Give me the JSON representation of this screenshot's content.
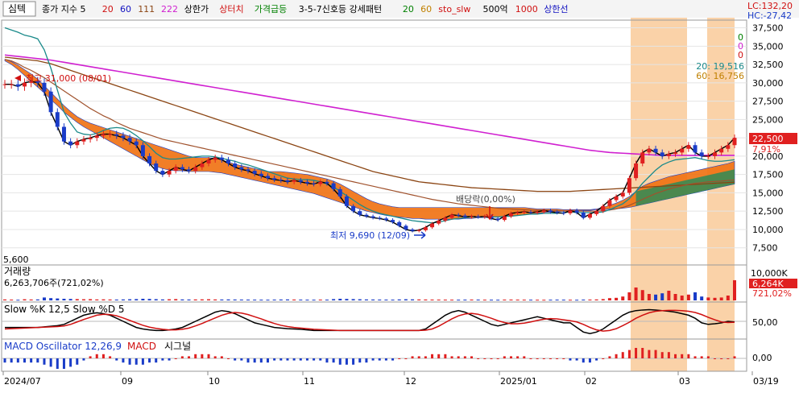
{
  "toolbar": {
    "tab_label": "심텍",
    "items": [
      {
        "label": "종가 지수 5",
        "color": "#000000"
      },
      {
        "label": "20",
        "color": "#d01010"
      },
      {
        "label": "60",
        "color": "#1010c0"
      },
      {
        "label": "111",
        "color": "#8b4513"
      },
      {
        "label": "222",
        "color": "#d020d0"
      },
      {
        "label": "상한가",
        "color": "#000000"
      },
      {
        "label": "상터치",
        "color": "#d01010"
      },
      {
        "label": "가격급등",
        "color": "#008000"
      },
      {
        "label": "3-5-7신호등 강세패턴",
        "color": "#000000"
      },
      {
        "label": "20",
        "color": "#008000"
      },
      {
        "label": "60",
        "color": "#c08000"
      },
      {
        "label": "sto_slw",
        "color": "#d01010"
      },
      {
        "label": "500억",
        "color": "#000000"
      },
      {
        "label": "1000",
        "color": "#d01010"
      },
      {
        "label": "상한선",
        "color": "#1010c0"
      }
    ]
  },
  "price_panel": {
    "lc_label": "LC:132,20",
    "hc_label": "HC:-27,42",
    "current_price": "22,500",
    "current_pct": "7,91%",
    "ma20_label": "20: 19,516",
    "ma60_label": "60: 16,756",
    "zero_labels": [
      "0",
      "0",
      "0"
    ],
    "bottom_label": "5,600",
    "high_annotation": "최고 31,000 (08/01)",
    "low_annotation": "최저 9,690 (12/09)",
    "dividend_annotation": "배당락(0,00%)"
  },
  "volume_panel": {
    "title": "거래량",
    "value_text": "6,263,706주(721,02%)",
    "axis_label": "10,000K",
    "current_label": "6,264K",
    "current_pct": "721,02%"
  },
  "stoch_panel": {
    "title": "Slow %K 12,5  Slow %D 5",
    "axis_label": "50,00"
  },
  "macd_panel": {
    "title_prefix": "MACD Oscillator 12,26,9",
    "title_macd": "MACD",
    "title_signal": "시그널",
    "axis_label": "0,00"
  },
  "x_axis": {
    "labels": [
      "2024/07",
      "09",
      "10",
      "11",
      "12",
      "2025/01",
      "02",
      "03",
      "03/19"
    ]
  },
  "colors": {
    "up": "#e02020",
    "down": "#1a3cc8",
    "ma5": "#000000",
    "ma20": "#1a8a8a",
    "ma60": "#8b4513",
    "ma222": "#d020d0",
    "cloud_orange": "#f07010",
    "cloud_green": "#2e8b57",
    "highlight": "#fad2a8",
    "price_tag_bg": "#e02020"
  },
  "chart_data": {
    "type": "candlestick",
    "title": "",
    "y_ticks": [
      7500,
      10000,
      12500,
      15000,
      17500,
      20000,
      22500,
      25000,
      27500,
      30000,
      32500,
      35000,
      37500
    ],
    "ylim": [
      5600,
      38000
    ],
    "x_categories": [
      "2024/07",
      "09",
      "10",
      "11",
      "12",
      "2025/01",
      "02",
      "03",
      "03/19"
    ],
    "closes": [
      29800,
      29800,
      29500,
      30000,
      30200,
      30000,
      28800,
      26000,
      24000,
      22000,
      21500,
      22000,
      22300,
      22500,
      22800,
      23000,
      23000,
      22800,
      22500,
      22000,
      21500,
      20000,
      19000,
      18000,
      17500,
      18000,
      18500,
      18200,
      18000,
      18500,
      19000,
      19500,
      19800,
      19500,
      19000,
      18500,
      18200,
      18000,
      17600,
      17300,
      17000,
      16800,
      16700,
      16500,
      16700,
      16500,
      16300,
      16200,
      16500,
      16300,
      15500,
      14500,
      13200,
      12500,
      12000,
      11800,
      11600,
      11500,
      11300,
      11000,
      10500,
      10000,
      9800,
      9900,
      10300,
      10800,
      11200,
      11600,
      12000,
      11900,
      11700,
      11800,
      11700,
      11800,
      11500,
      11300,
      11800,
      12200,
      12300,
      12400,
      12300,
      12400,
      12600,
      12400,
      12300,
      12200,
      12600,
      12300,
      11600,
      12100,
      12500,
      13200,
      14000,
      14500,
      15000,
      17000,
      19000,
      20500,
      21000,
      20500,
      20000,
      20300,
      20500,
      21000,
      21500,
      20500,
      20000,
      20000,
      20500,
      21000,
      21500,
      22500
    ],
    "ma20": [
      37500,
      37200,
      36900,
      36500,
      36300,
      36000,
      34500,
      32000,
      29000,
      26000,
      24500,
      23300,
      23000,
      22900,
      23100,
      23500,
      23800,
      23900,
      23800,
      23400,
      22800,
      22100,
      21300,
      20400,
      19800,
      19600,
      19600,
      19700,
      19800,
      19900,
      20000,
      20000,
      19900,
      19700,
      19500,
      19300,
      19000,
      18800,
      18500,
      18200,
      17900,
      17600,
      17300,
      17000,
      16900,
      16800,
      16800,
      16700,
      16500,
      16200,
      15800,
      15200,
      14600,
      14000,
      13400,
      12900,
      12500,
      12200,
      12000,
      11800,
      11600,
      11400,
      11200,
      11100,
      11000,
      10900,
      11000,
      11200,
      11400,
      11500,
      11600,
      11700,
      11700,
      11700,
      11700,
      11700,
      11800,
      11800,
      11900,
      12000,
      12100,
      12100,
      12200,
      12200,
      12200,
      12300,
      12400,
      12300,
      12300,
      12300,
      12300,
      12400,
      12700,
      13100,
      13500,
      14200,
      15200,
      16300,
      17200,
      18100,
      18800,
      19200,
      19500,
      19600,
      19700,
      19800,
      19600,
      19400,
      19300,
      19300,
      19400,
      19516
    ],
    "ma60": [
      33200,
      33000,
      32600,
      32100,
      31700,
      31200,
      30700,
      30100,
      29500,
      28900,
      28300,
      27700,
      27100,
      26500,
      26000,
      25500,
      25100,
      24600,
      24200,
      23800,
      23500,
      23200,
      22900,
      22600,
      22300,
      22100,
      21900,
      21700,
      21500,
      21300,
      21100,
      20900,
      20700,
      20500,
      20300,
      20100,
      19900,
      19700,
      19500,
      19300,
      19100,
      18900,
      18700,
      18500,
      18300,
      18100,
      17900,
      17700,
      17500,
      17300,
      17100,
      16900,
      16700,
      16500,
      16300,
      16100,
      15900,
      15700,
      15500,
      15300,
      15100,
      14900,
      14700,
      14500,
      14300,
      14100,
      13950,
      13800,
      13650,
      13500,
      13400,
      13300,
      13200,
      13100,
      13000,
      12900,
      12850,
      12800,
      12750,
      12700,
      12650,
      12600,
      12600,
      12550,
      12550,
      12500,
      12500,
      12500,
      12500,
      12500,
      12500,
      12550,
      12650,
      12800,
      13000,
      13300,
      13700,
      14100,
      14500,
      14900,
      15200,
      15500,
      15750,
      15950,
      16150,
      16300,
      16400,
      16500,
      16550,
      16600,
      16700,
      16756
    ],
    "ma111": [
      33500,
      33400,
      33300,
      33200,
      33100,
      33000,
      32800,
      32600,
      32300,
      32000,
      31700,
      31400,
      31100,
      30800,
      30500,
      30200,
      29900,
      29600,
      29300,
      29000,
      28700,
      28400,
      28100,
      27800,
      27500,
      27200,
      26900,
      26600,
      26300,
      26000,
      25700,
      25400,
      25100,
      24800,
      24500,
      24200,
      23900,
      23600,
      23300,
      23000,
      22700,
      22400,
      22100,
      21800,
      21500,
      21200,
      20900,
      20600,
      20300,
      20000,
      19700,
      19400,
      19100,
      18800,
      18500,
      18200,
      17900,
      17700,
      17500,
      17300,
      17100,
      16900,
      16700,
      16500,
      16400,
      16300,
      16200,
      16100,
      16000,
      15900,
      15800,
      15700,
      15650,
      15600,
      15550,
      15500,
      15450,
      15400,
      15350,
      15300,
      15250,
      15200,
      15200,
      15200,
      15200,
      15200,
      15200,
      15250,
      15300,
      15350,
      15400,
      15450,
      15500,
      15550,
      15600,
      15650,
      15700,
      15750,
      15800,
      15850,
      15900,
      15950,
      16000,
      16050,
      16100,
      16150,
      16200,
      16250,
      16300,
      16350,
      16400,
      16450
    ],
    "ma222": [
      33800,
      33700,
      33600,
      33500,
      33400,
      33300,
      33200,
      33100,
      32950,
      32800,
      32650,
      32500,
      32350,
      32200,
      32050,
      31900,
      31750,
      31600,
      31450,
      31300,
      31150,
      31000,
      30850,
      30700,
      30550,
      30400,
      30250,
      30100,
      29950,
      29800,
      29650,
      29500,
      29350,
      29200,
      29050,
      28900,
      28750,
      28600,
      28450,
      28300,
      28150,
      28000,
      27850,
      27700,
      27550,
      27400,
      27250,
      27100,
      26950,
      26800,
      26650,
      26500,
      26350,
      26200,
      26050,
      25900,
      25750,
      25600,
      25450,
      25300,
      25150,
      25000,
      24850,
      24700,
      24550,
      24400,
      24250,
      24100,
      23950,
      23800,
      23650,
      23500,
      23350,
      23200,
      23050,
      22900,
      22750,
      22600,
      22450,
      22300,
      22150,
      22000,
      21850,
      21700,
      21550,
      21400,
      21250,
      21100,
      20950,
      20800,
      20700,
      20600,
      20500,
      20450,
      20400,
      20350,
      20300,
      20250,
      20200,
      20150,
      20100,
      20100,
      20100,
      20100,
      20100,
      20100,
      20100,
      20100,
      20100,
      20100,
      20100,
      20100
    ],
    "cloud_upper": [
      33200,
      32900,
      32400,
      31800,
      31200,
      30500,
      29600,
      28700,
      27800,
      26900,
      26100,
      25400,
      24900,
      24500,
      24200,
      23900,
      23600,
      23300,
      23000,
      22700,
      22400,
      22100,
      21800,
      21500,
      21200,
      20900,
      20600,
      20300,
      20000,
      19800,
      19800,
      19800,
      19700,
      19500,
      19200,
      18900,
      18700,
      18500,
      18300,
      18100,
      17900,
      17900,
      17900,
      17800,
      17700,
      17600,
      17500,
      17300,
      17100,
      16900,
      16600,
      16200,
      15700,
      15200,
      14700,
      14200,
      13800,
      13500,
      13300,
      13100,
      13000,
      13000,
      13000,
      13000,
      13000,
      13000,
      13000,
      13000,
      13000,
      13000,
      13000,
      13000,
      13000,
      13000,
      13000,
      13000,
      13000,
      13000,
      13000,
      13000,
      12900,
      12800,
      12800,
      12800,
      12800,
      12700,
      12700,
      12700,
      12700,
      12700,
      12800,
      13000,
      13300,
      13600,
      14000,
      14500,
      15200,
      15900,
      16300,
      16600,
      16900,
      17200,
      17400,
      17600,
      17800,
      18000,
      18200,
      18400,
      18600,
      18800,
      19000,
      19300
    ],
    "cloud_lower": [
      33000,
      32500,
      31800,
      31000,
      30200,
      29400,
      28600,
      27700,
      26900,
      26000,
      25300,
      24600,
      24000,
      23500,
      23000,
      22500,
      22000,
      21500,
      21000,
      20500,
      20000,
      19500,
      19000,
      18600,
      18300,
      18100,
      18000,
      18000,
      17900,
      17900,
      17900,
      17900,
      17800,
      17700,
      17500,
      17300,
      17100,
      16900,
      16700,
      16500,
      16300,
      16100,
      15900,
      15700,
      15500,
      15300,
      15100,
      14900,
      14600,
      14300,
      14000,
      13700,
      13400,
      13100,
      12800,
      12500,
      12300,
      12100,
      11900,
      11800,
      11700,
      11600,
      11500,
      11500,
      11400,
      11400,
      11400,
      11400,
      11400,
      11400,
      11500,
      11500,
      11600,
      11600,
      11700,
      11700,
      11800,
      11900,
      11900,
      12000,
      12100,
      12200,
      12300,
      12400,
      12400,
      12500,
      12500,
      12500,
      12600,
      12600,
      12700,
      12700,
      12800,
      12800,
      12900,
      13000,
      13200,
      13400,
      13600,
      13800,
      14000,
      14200,
      14400,
      14600,
      14800,
      15000,
      15200,
      15400,
      15600,
      15800,
      16000,
      16200
    ],
    "volume_k": [
      300,
      250,
      200,
      350,
      280,
      300,
      900,
      700,
      600,
      500,
      450,
      400,
      350,
      380,
      300,
      320,
      280,
      260,
      300,
      350,
      400,
      500,
      450,
      380,
      300,
      350,
      400,
      300,
      280,
      300,
      320,
      350,
      300,
      280,
      300,
      280,
      260,
      250,
      240,
      230,
      220,
      250,
      280,
      300,
      270,
      250,
      230,
      220,
      250,
      240,
      400,
      500,
      450,
      400,
      350,
      300,
      280,
      260,
      250,
      240,
      300,
      350,
      320,
      300,
      280,
      260,
      250,
      240,
      230,
      220,
      240,
      260,
      250,
      230,
      220,
      210,
      250,
      260,
      240,
      230,
      220,
      210,
      200,
      220,
      240,
      230,
      210,
      200,
      250,
      260,
      300,
      400,
      700,
      800,
      1200,
      2500,
      4000,
      3200,
      2000,
      1800,
      2200,
      3000,
      2000,
      1500,
      1800,
      2500,
      1200,
      900,
      800,
      900,
      1500,
      6264
    ],
    "stoch_k": [
      30,
      30,
      30,
      30,
      30,
      30,
      32,
      34,
      36,
      40,
      50,
      60,
      70,
      75,
      78,
      75,
      70,
      60,
      50,
      40,
      30,
      25,
      22,
      20,
      20,
      22,
      25,
      30,
      40,
      50,
      60,
      70,
      80,
      85,
      82,
      75,
      65,
      55,
      45,
      40,
      35,
      30,
      28,
      26,
      25,
      24,
      22,
      20,
      20,
      20,
      20,
      20,
      20,
      20,
      20,
      20,
      20,
      20,
      20,
      20,
      20,
      20,
      20,
      20,
      25,
      40,
      55,
      70,
      80,
      85,
      80,
      70,
      60,
      50,
      40,
      35,
      40,
      45,
      50,
      55,
      60,
      65,
      60,
      55,
      50,
      45,
      45,
      30,
      15,
      10,
      15,
      25,
      40,
      55,
      70,
      80,
      85,
      87,
      88,
      87,
      85,
      83,
      80,
      75,
      70,
      60,
      45,
      40,
      42,
      45,
      50,
      48
    ],
    "stoch_d": [
      25,
      26,
      27,
      28,
      29,
      30,
      31,
      32,
      33,
      35,
      40,
      48,
      56,
      63,
      70,
      73,
      72,
      68,
      61,
      53,
      45,
      37,
      31,
      27,
      24,
      22,
      22,
      24,
      28,
      35,
      43,
      52,
      61,
      70,
      76,
      79,
      77,
      72,
      65,
      58,
      50,
      43,
      37,
      33,
      30,
      28,
      26,
      24,
      23,
      22,
      21,
      20,
      20,
      20,
      20,
      20,
      20,
      20,
      20,
      20,
      20,
      20,
      20,
      20,
      21,
      25,
      34,
      46,
      58,
      68,
      74,
      76,
      73,
      67,
      60,
      52,
      46,
      42,
      42,
      44,
      48,
      53,
      57,
      59,
      58,
      55,
      52,
      48,
      40,
      30,
      22,
      18,
      20,
      26,
      36,
      47,
      60,
      70,
      78,
      83,
      85,
      86,
      86,
      85,
      83,
      79,
      72,
      63,
      55,
      48,
      46,
      47
    ],
    "macd_osc": [
      -2,
      -2,
      -2,
      -2,
      -2,
      -2,
      -3,
      -4,
      -5,
      -5,
      -4,
      -3,
      -1,
      1,
      2,
      2,
      1,
      -1,
      -2,
      -3,
      -3,
      -3,
      -2,
      -2,
      -1,
      -1,
      0,
      1,
      1,
      2,
      2,
      2,
      1,
      1,
      0,
      -1,
      -1,
      -2,
      -2,
      -2,
      -2,
      -1,
      -1,
      -1,
      -1,
      -1,
      -1,
      -1,
      -1,
      -2,
      -2,
      -3,
      -3,
      -3,
      -2,
      -2,
      -1,
      -1,
      -1,
      -1,
      0,
      0,
      1,
      1,
      1,
      2,
      2,
      2,
      1,
      1,
      1,
      1,
      0,
      0,
      0,
      0,
      1,
      1,
      1,
      1,
      0,
      0,
      0,
      0,
      0,
      0,
      -1,
      -1,
      -2,
      -2,
      -1,
      0,
      1,
      2,
      3,
      4,
      5,
      5,
      4,
      4,
      3,
      3,
      2,
      2,
      2,
      1,
      1,
      1,
      0,
      0,
      0,
      1
    ]
  }
}
